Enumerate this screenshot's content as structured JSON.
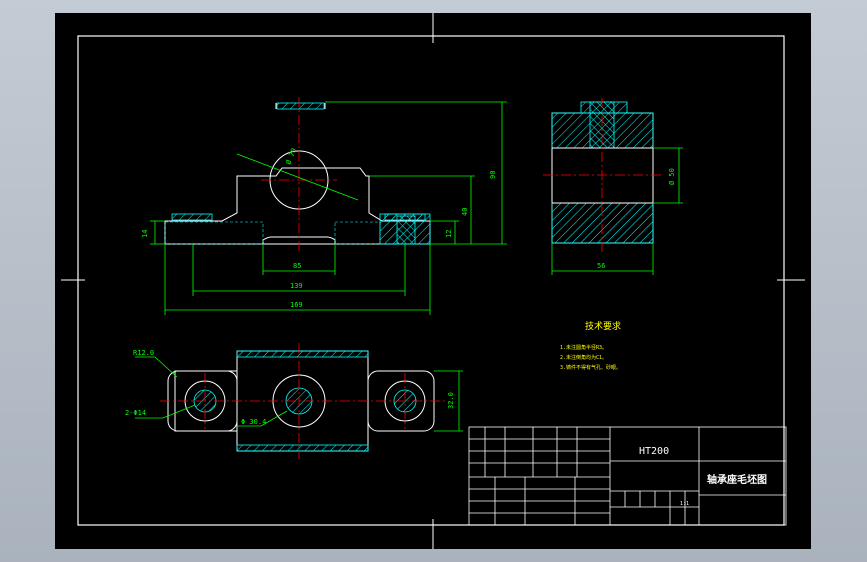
{
  "colors": {
    "background": "#000000",
    "window_bg": "#b5bec8",
    "frame": "#ffffff",
    "outline": "#ffffff",
    "hatch": "#00ffff",
    "dimension": "#00ff00",
    "centerline": "#ff0000",
    "text_yellow": "#ffff00"
  },
  "front_view": {
    "dims": {
      "d1": "Ø 70",
      "height_total": "90",
      "height_mid": "40",
      "height_low": "12",
      "base_h": "14",
      "w_inner": "85",
      "w_mid": "139",
      "w_total": "169"
    }
  },
  "side_view": {
    "dims": {
      "bore": "Ø 50",
      "width": "56"
    }
  },
  "top_view": {
    "dims": {
      "r1": "R12.0",
      "holes": "2-Φ14",
      "bore": "Φ 30.4",
      "side": "32.0"
    }
  },
  "tech_req": {
    "title": "技术要求",
    "items": [
      "1.未注圆角半径R3。",
      "2.未注倒角均为C1。",
      "3.铸件不得有气孔、砂眼。"
    ]
  },
  "title_block": {
    "material": "HT200",
    "part_name": "轴承座毛坯图",
    "scale_label": "1:1"
  }
}
